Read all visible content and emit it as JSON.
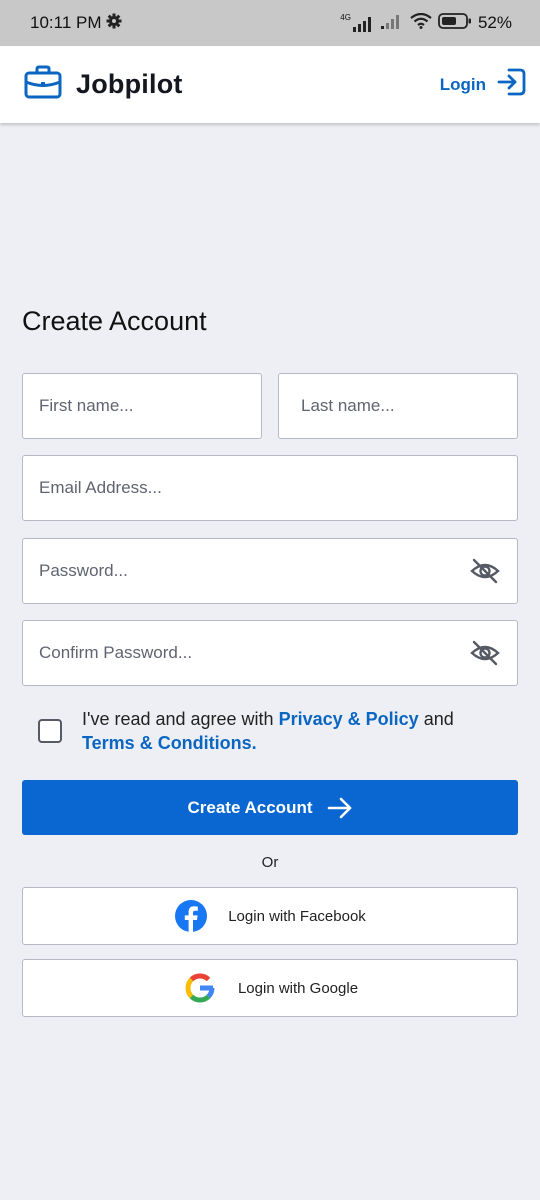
{
  "status_bar": {
    "time": "10:11 PM",
    "network": "4G",
    "battery": "52%"
  },
  "header": {
    "brand": "Jobpilot",
    "login_label": "Login"
  },
  "form": {
    "title": "Create Account",
    "first_name_placeholder": "First name...",
    "last_name_placeholder": "Last name...",
    "email_placeholder": "Email Address...",
    "password_placeholder": "Password...",
    "confirm_password_placeholder": "Confirm Password...",
    "agree_prefix": "I've read and agree with",
    "privacy_link": "Privacy & Policy",
    "agree_and": "and",
    "terms_link": "Terms & Conditions.",
    "submit_label": "Create Account"
  },
  "social": {
    "or_label": "Or",
    "facebook_label": "Login with Facebook",
    "google_label": "Login with Google"
  },
  "colors": {
    "accent": "#0a66d0",
    "page_background": "#edeff4",
    "status_bar_background": "#c8c8c8",
    "facebook_blue": "#1877f2"
  },
  "icons": {
    "brand": "briefcase-icon",
    "login": "login-arrow-icon",
    "password_toggle": "eye-off-icon",
    "submit": "arrow-right-icon",
    "facebook": "facebook-logo-icon",
    "google": "google-logo-icon"
  }
}
